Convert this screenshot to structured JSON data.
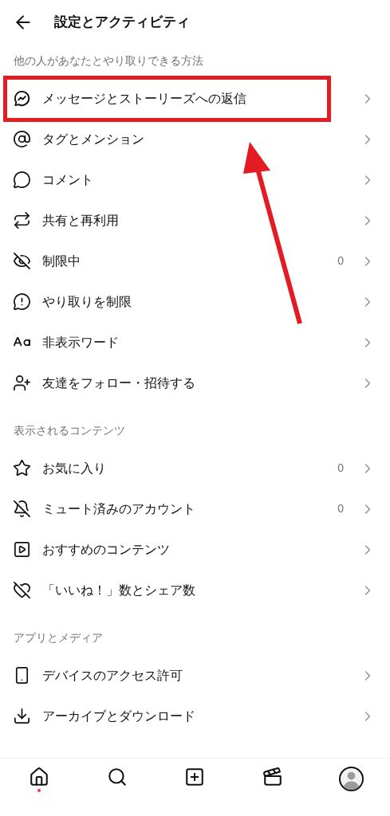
{
  "header": {
    "title": "設定とアクティビティ"
  },
  "sections": [
    {
      "heading": "他の人があなたとやり取りできる方法",
      "items": [
        {
          "label": "メッセージとストーリーズへの返信",
          "highlighted": true
        },
        {
          "label": "タグとメンション",
          "highlighted": false
        },
        {
          "label": "コメント",
          "highlighted": false
        },
        {
          "label": "共有と再利用",
          "highlighted": false
        },
        {
          "label": "制限中",
          "count": "0",
          "highlighted": false
        },
        {
          "label": "やり取りを制限",
          "highlighted": false
        },
        {
          "label": "非表示ワード",
          "highlighted": false
        },
        {
          "label": "友達をフォロー・招待する",
          "highlighted": false
        }
      ]
    },
    {
      "heading": "表示されるコンテンツ",
      "items": [
        {
          "label": "お気に入り",
          "count": "0",
          "highlighted": false
        },
        {
          "label": "ミュート済みのアカウント",
          "count": "0",
          "highlighted": false
        },
        {
          "label": "おすすめのコンテンツ",
          "highlighted": false
        },
        {
          "label": "「いいね！」数とシェア数",
          "highlighted": false
        }
      ]
    },
    {
      "heading": "アプリとメディア",
      "items": [
        {
          "label": "デバイスのアクセス許可",
          "highlighted": false
        },
        {
          "label": "アーカイブとダウンロード",
          "highlighted": false
        }
      ]
    }
  ],
  "bottom_nav": [
    {
      "notification": true
    },
    {
      "notification": false
    },
    {
      "notification": false
    },
    {
      "notification": false
    },
    {
      "notification": false
    }
  ]
}
